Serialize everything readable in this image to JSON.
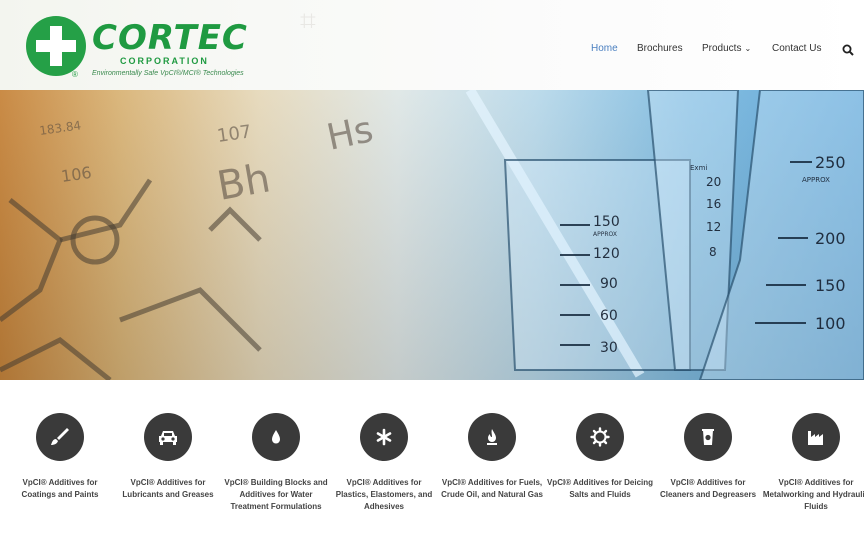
{
  "logo": {
    "name": "CORTEC",
    "corporation": "CORPORATION",
    "tagline": "Environmentally Safe VpCI®/MCI® Technologies",
    "registered": "®"
  },
  "nav": {
    "items": [
      {
        "label": "Home",
        "active": true
      },
      {
        "label": "Brochures",
        "active": false
      },
      {
        "label": "Products",
        "active": false,
        "has_dropdown": true
      },
      {
        "label": "Contact Us",
        "active": false
      }
    ],
    "search_icon": "search-icon"
  },
  "hero": {
    "beaker_marks_small": [
      "150",
      "APPROX",
      "120",
      "90",
      "60",
      "30"
    ],
    "cylinder_marks": [
      "Exmi",
      "20",
      "16",
      "12",
      "8"
    ],
    "flask_marks": [
      "250",
      "APPROX",
      "200",
      "150",
      "100"
    ],
    "sketch_text": [
      "183.84",
      "107",
      "106",
      "Bh",
      "Hs"
    ]
  },
  "features": [
    {
      "icon": "paintbrush-icon",
      "label": "VpCI® Additives for Coatings and Paints"
    },
    {
      "icon": "car-icon",
      "label": "VpCI® Additives for Lubricants and Greases"
    },
    {
      "icon": "water-drop-icon",
      "label": "VpCI® Building Blocks and Additives for Water Treatment Formulations"
    },
    {
      "icon": "asterisk-icon",
      "label": "VpCI® Additives for Plastics, Elastomers, and Adhesives"
    },
    {
      "icon": "fuel-flame-icon",
      "label": "VpCI® Additives for Fuels, Crude Oil, and Natural Gas"
    },
    {
      "icon": "gear-icon",
      "label": "VpCI® Additives for Deicing Salts and Fluids"
    },
    {
      "icon": "cleaner-bucket-icon",
      "label": "VpCI® Additives for Cleaners and Degreasers"
    },
    {
      "icon": "factory-icon",
      "label": "VpCI® Additives for Metalworking and Hydraulic Fluids"
    }
  ]
}
